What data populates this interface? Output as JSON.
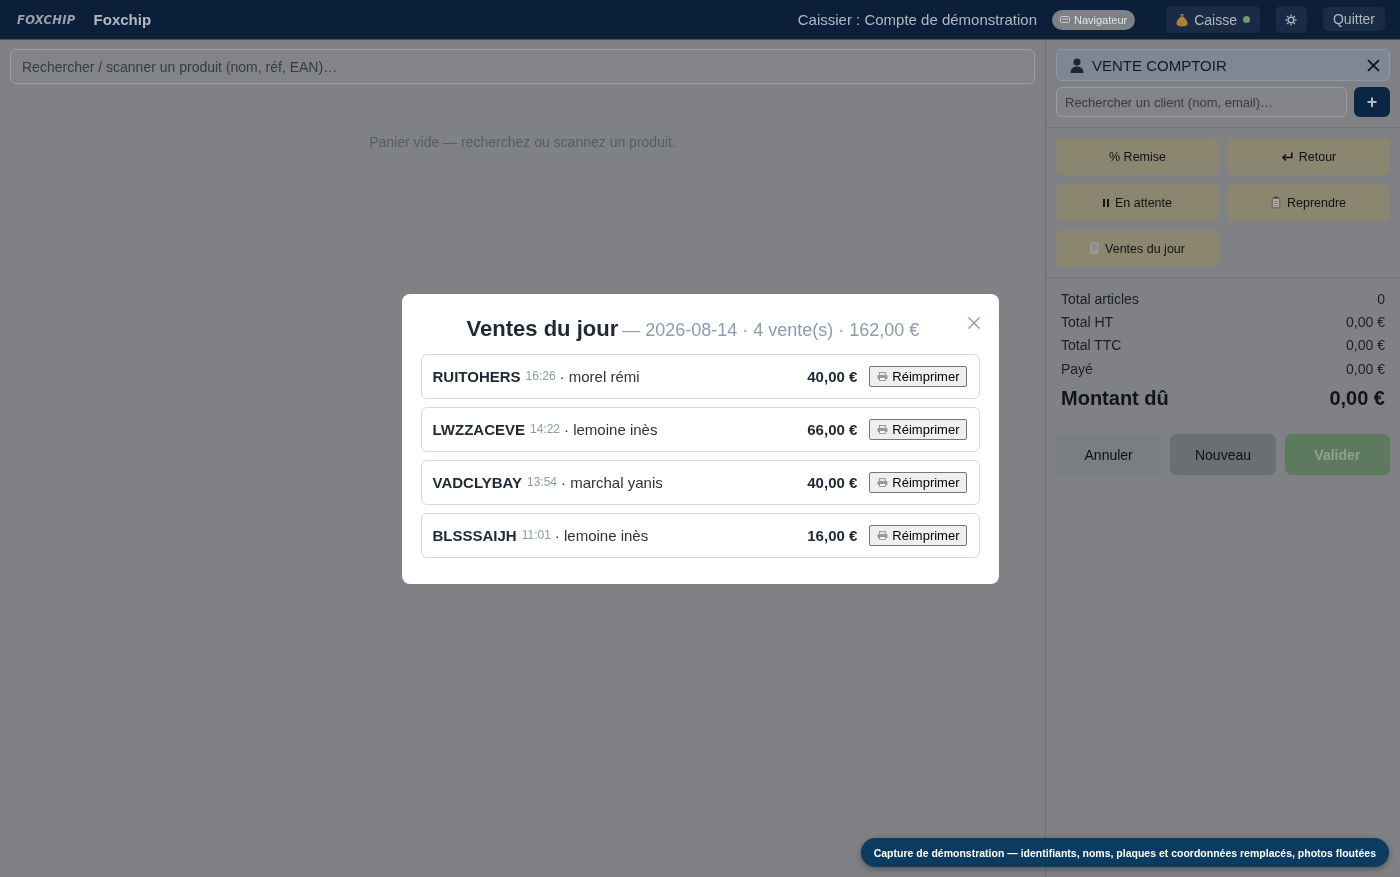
{
  "topbar": {
    "logo": "FOXCHIP",
    "app_name": "Foxchip",
    "cashier": "Caissier : Compte de démonstration",
    "mode_badge": "Navigateur",
    "register_button": {
      "label": "Caisse",
      "online": true
    },
    "quit_button": "Quitter"
  },
  "product_search": {
    "placeholder": "Rechercher / scanner un produit (nom, réf, EAN)…"
  },
  "cart": {
    "empty_message": "Panier vide — recherchez ou scannez un produit."
  },
  "customer": {
    "name": "VENTE COMPTOIR",
    "search_placeholder": "Rechercher un client (nom, email)…",
    "add_button": "+"
  },
  "actions": [
    {
      "label": "% Remise"
    },
    {
      "label": "Retour"
    },
    {
      "label": "En attente"
    },
    {
      "label": "Reprendre"
    },
    {
      "label": "Ventes du jour"
    }
  ],
  "totals": [
    {
      "label": "Total articles",
      "value": "0"
    },
    {
      "label": "Total HT",
      "value": "0,00 €"
    },
    {
      "label": "Total TTC",
      "value": "0,00 €"
    },
    {
      "label": "Payé",
      "value": "0,00 €"
    }
  ],
  "amount_due": {
    "label": "Montant dû",
    "value": "0,00 €"
  },
  "footer_buttons": [
    {
      "label": "Annuler",
      "kind": "secondary",
      "disabled": false
    },
    {
      "label": "Nouveau",
      "kind": "neutral",
      "disabled": false
    },
    {
      "label": "Valider",
      "kind": "primary",
      "disabled": true
    }
  ],
  "dialog": {
    "title": "Ventes du jour",
    "subtitle": "— 2026-08-14 · 4 vente(s) · 162,00 €",
    "sales": [
      {
        "code": "RUITOHERS",
        "time": "16:26",
        "customer": "· morel rémi",
        "amount": "40,00 €",
        "reprint_button": "Réimprimer"
      },
      {
        "code": "LWZZACEVE",
        "time": "14:22",
        "customer": "· lemoine inès",
        "amount": "66,00 €",
        "reprint_button": "Réimprimer"
      },
      {
        "code": "VADCLYBAY",
        "time": "13:54",
        "customer": "· marchal yanis",
        "amount": "40,00 €",
        "reprint_button": "Réimprimer"
      },
      {
        "code": "BLSSSAIJH",
        "time": "11:01",
        "customer": "· lemoine inès",
        "amount": "16,00 €",
        "reprint_button": "Réimprimer"
      }
    ]
  },
  "notice": "Capture de démonstration — identifiants, noms, plaques et coordonnées remplacés, photos floutées"
}
